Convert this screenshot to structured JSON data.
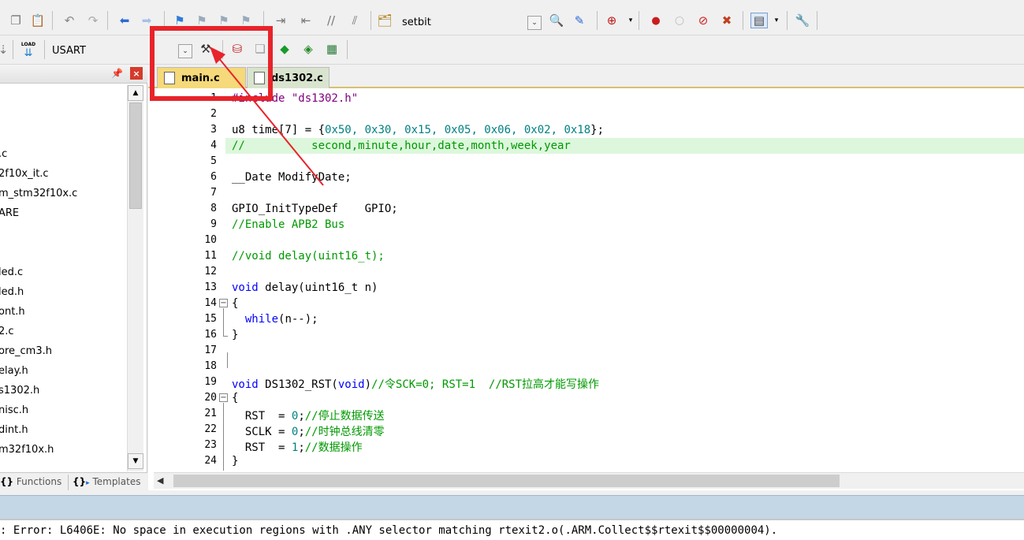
{
  "toolbar1": {
    "target_select_label": "setbit"
  },
  "toolbar2": {
    "target_name": "USART",
    "load_label": "LOAD"
  },
  "project_panel": {
    "pin_icon": "pin-icon",
    "items": [
      ".c",
      "2f10x_it.c",
      "m_stm32f10x.c",
      "ARE",
      "led.c",
      "led.h",
      "ont.h",
      "2.c",
      "ore_cm3.h",
      "elay.h",
      "s1302.h",
      "nisc.h",
      "dint.h",
      "m32f10x.h"
    ],
    "bottom_tabs": [
      {
        "label": "Functions"
      },
      {
        "label": "Templates"
      }
    ]
  },
  "editor": {
    "tabs": [
      {
        "label": "main.c",
        "active": true
      },
      {
        "label": "ds1302.c",
        "active": false
      }
    ],
    "line_numbers": [
      "1",
      "2",
      "3",
      "4",
      "5",
      "6",
      "7",
      "8",
      "9",
      "10",
      "11",
      "12",
      "13",
      "14",
      "15",
      "16",
      "17",
      "18",
      "19",
      "20",
      "21",
      "22",
      "23",
      "24"
    ],
    "lines": {
      "l1_pre": "#include ",
      "l1_str": "\"ds1302.h\"",
      "l3_a": "u8 time[7] = {",
      "l3_b": "0x50, 0x30, 0x15, 0x05, 0x06, 0x02, 0x18",
      "l3_c": "};",
      "l4": "//          second,minute,hour,date,month,week,year",
      "l6": "__Date ModifyDate;",
      "l8": "GPIO_InitTypeDef    GPIO;",
      "l9": "//Enable APB2 Bus",
      "l11": "//void delay(uint16_t);",
      "l13_kw": "void",
      "l13_rest": " delay(uint16_t n)",
      "l14": "{",
      "l15_kw": "while",
      "l15_rest": "(n--);",
      "l16": "}",
      "l19_kw": "void",
      "l19_mid": " DS1302_RST(",
      "l19_kw2": "void",
      "l19_paren": ")",
      "l19_cm": "//令SCK=0; RST=1  //RST拉高才能写操作",
      "l20": "{",
      "l21_a": "RST  = ",
      "l21_n": "0",
      "l21_b": ";",
      "l21_cm": "//停止数据传送",
      "l22_a": "SCLK = ",
      "l22_n": "0",
      "l22_b": ";",
      "l22_cm": "//时钟总线清零",
      "l23_a": "RST  = ",
      "l23_n": "1",
      "l23_b": ";",
      "l23_cm": "//数据操作",
      "l24": "}"
    }
  },
  "output": {
    "error_text": ": Error: L6406E: No space in execution regions with .ANY selector matching rtexit2.o(.ARM.Collect$$rtexit$$00000004)."
  },
  "colors": {
    "annotation_red": "#e8232a",
    "keyword_blue": "#0000ff",
    "comment_green": "#009900",
    "number_teal": "#008080",
    "current_line": "#dcf7dc"
  }
}
